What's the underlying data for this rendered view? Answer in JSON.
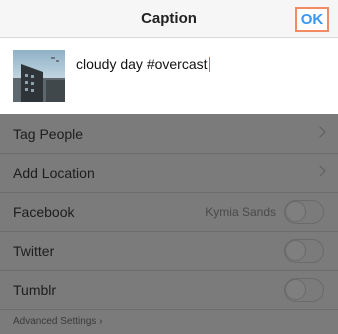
{
  "header": {
    "title": "Caption",
    "ok_label": "OK"
  },
  "caption": {
    "text": "cloudy day #overcast"
  },
  "options": [
    {
      "label": "Tag People",
      "icon": "chevron-right-icon"
    },
    {
      "label": "Add Location",
      "icon": "chevron-right-icon"
    }
  ],
  "share": [
    {
      "label": "Facebook",
      "account": "Kymia Sands",
      "enabled": false
    },
    {
      "label": "Twitter",
      "enabled": false
    },
    {
      "label": "Tumblr",
      "enabled": false
    }
  ],
  "advanced": {
    "label": "Advanced Settings ›"
  },
  "colors": {
    "accent": "#3897f0",
    "ok_highlight": "#f28a63",
    "overlay": "#7b7b7b"
  }
}
